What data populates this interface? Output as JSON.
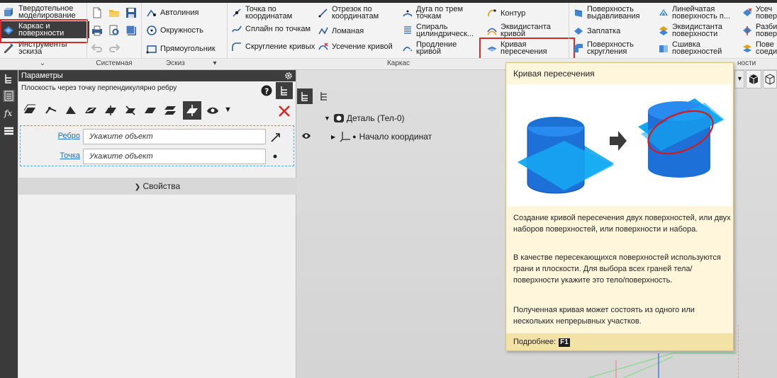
{
  "modes": {
    "solid": "Твердотельное моделирование",
    "frame": "Каркас и поверхности",
    "sketch_tools": "Инструменты эскиза"
  },
  "groups": {
    "system": "Системная",
    "sketch": "Эскиз",
    "frame": "Каркас"
  },
  "sketch_buttons": {
    "autoline": "Автолиния",
    "circle": "Окружность",
    "rectangle": "Прямоугольник"
  },
  "frame_buttons": {
    "point_coords": "Точка по координатам",
    "segment_coords": "Отрезок по координатам",
    "arc_three": "Дуга по трем точкам",
    "contour": "Контур",
    "spline_points": "Сплайн по точкам",
    "polyline": "Ломаная",
    "spiral_cyl": "Спираль цилиндрическ...",
    "equidistant_curve": "Эквидистанта кривой",
    "round_curves": "Скругление кривых",
    "trim_curve": "Усечение кривой",
    "extend_curve": "Продление кривой",
    "intersection_curve": "Кривая пересечения"
  },
  "surface_buttons": {
    "extrude_surface": "Поверхность выдавливания",
    "patch": "Заплатка",
    "round_surface": "Поверхность скругления",
    "ruled_surface": "Линейчатая поверхность п...",
    "equidistant_surface": "Эквидистанта поверхности",
    "stitch_surfaces": "Сшивка поверхностей",
    "trim_partial_1": "Усеч",
    "trim_partial_2": "повер",
    "split_partial_1": "Разби",
    "split_partial_2": "повер",
    "surf_partial_1": "Пове",
    "surf_partial_2": "соеди",
    "surfaces_group_partial": "ности"
  },
  "params_panel": {
    "title": "Параметры",
    "subtitle": "Плоскость через точку перпендикулярно ребру",
    "edge_label": "Ребро",
    "edge_value": "Укажите объект",
    "point_label": "Точка",
    "point_value": "Укажите объект",
    "properties": "Свойства"
  },
  "tree": {
    "part": "Деталь (Тел-0)",
    "origin": "Начало координат"
  },
  "tooltip": {
    "title": "Кривая пересечения",
    "p1": "Создание кривой пересечения двух поверхностей, или двух наборов поверхностей, или поверхности и набора.",
    "p2": "В качестве пересекающихся поверхностей используются грани и плоскости. Для выбора всех граней тела/поверхности укажите это тело/поверхность.",
    "p3": "Полученная кривая может состоять из одного или нескольких непрерывных участков.",
    "more": "Подробнее:",
    "key": "F1"
  },
  "colors": {
    "accent_red": "#d42a2a",
    "dark": "#3d3d3d",
    "tooltip_bg": "#fff6dc",
    "link": "#1f6dbd"
  }
}
